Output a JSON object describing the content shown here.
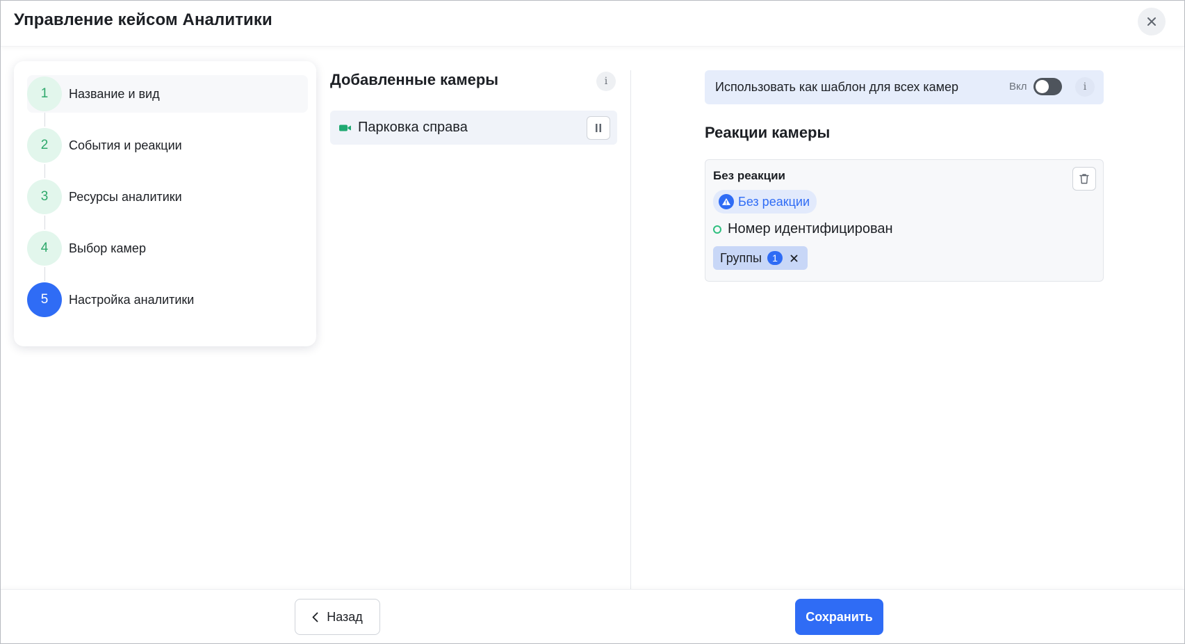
{
  "header": {
    "title": "Управление кейсом Аналитики",
    "close_icon": "close-icon"
  },
  "stepper": {
    "steps": [
      {
        "number": "1",
        "label": "Название и вид",
        "state": "done"
      },
      {
        "number": "2",
        "label": "События и реакции",
        "state": "done"
      },
      {
        "number": "3",
        "label": "Ресурсы аналитики",
        "state": "done"
      },
      {
        "number": "4",
        "label": "Выбор камер",
        "state": "done"
      },
      {
        "number": "5",
        "label": "Настройка аналитики",
        "state": "current"
      }
    ]
  },
  "cameras": {
    "title": "Добавленные камеры",
    "info_label": "i",
    "items": [
      {
        "name": "Парковка справа",
        "icon": "video-camera-icon",
        "action_icon": "pause-icon"
      }
    ]
  },
  "template": {
    "label": "Использовать как шаблон для всех камер",
    "toggle_label": "Вкл",
    "toggle_on": false,
    "info_label": "i"
  },
  "reactions": {
    "title": "Реакции камеры",
    "card": {
      "heading": "Без реакции",
      "chip_label": "Без реакции",
      "chip_icon": "warning-icon",
      "event": "Номер идентифицирован",
      "groups_label": "Группы",
      "groups_count": "1"
    }
  },
  "footer": {
    "back_label": "Назад",
    "save_label": "Сохранить"
  },
  "colors": {
    "accent": "#2f6cf5",
    "step_done_bg": "#e2f6ec",
    "step_done_text": "#2ea86b",
    "camera_icon": "#1fa971"
  }
}
